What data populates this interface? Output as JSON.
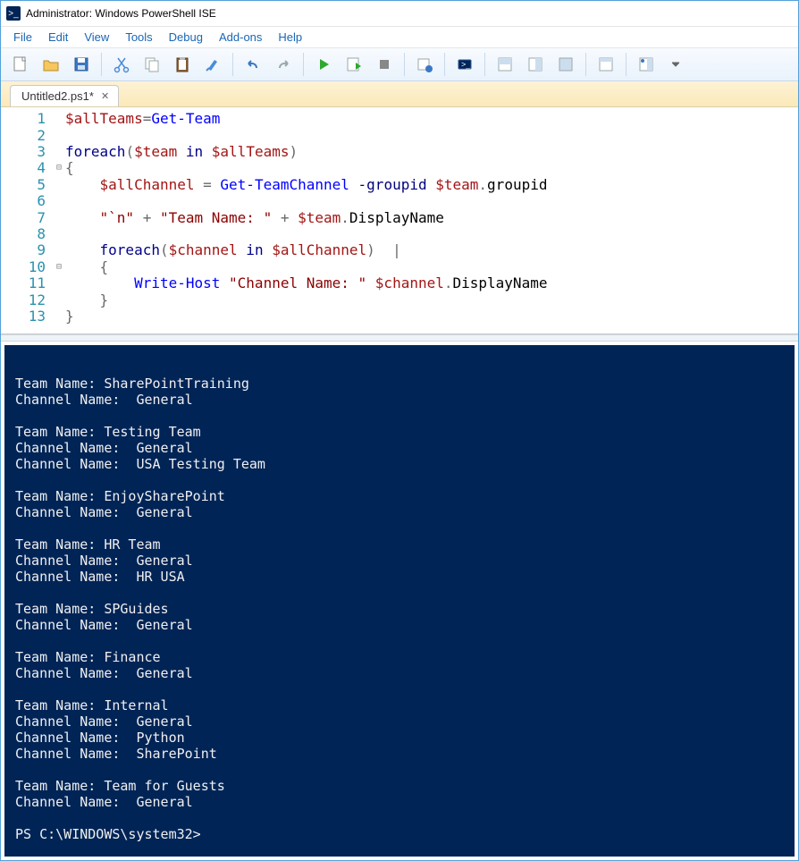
{
  "window": {
    "title": "Administrator: Windows PowerShell ISE"
  },
  "menu": {
    "items": [
      "File",
      "Edit",
      "View",
      "Tools",
      "Debug",
      "Add-ons",
      "Help"
    ]
  },
  "toolbar": {
    "buttons": [
      "new-file",
      "open-file",
      "save-file",
      "cut",
      "copy",
      "paste",
      "clear",
      "undo",
      "redo",
      "run",
      "run-selection",
      "stop",
      "breakpoint",
      "remote",
      "show-script",
      "show-console",
      "show-both",
      "show-command",
      "toggle-right-pane",
      "options"
    ]
  },
  "tabs": {
    "active": {
      "label": "Untitled2.ps1*",
      "close": "✕"
    }
  },
  "editor": {
    "lines": [
      {
        "n": 1,
        "tokens": [
          [
            "var",
            "$allTeams"
          ],
          [
            "op",
            "="
          ],
          [
            "cmd",
            "Get-Team"
          ]
        ]
      },
      {
        "n": 2,
        "tokens": []
      },
      {
        "n": 3,
        "tokens": [
          [
            "kw",
            "foreach"
          ],
          [
            "op",
            "("
          ],
          [
            "var",
            "$team"
          ],
          [
            "kw",
            " in "
          ],
          [
            "var",
            "$allTeams"
          ],
          [
            "op",
            ")"
          ]
        ]
      },
      {
        "n": 4,
        "fold": "⊟",
        "tokens": [
          [
            "op",
            "{"
          ]
        ]
      },
      {
        "n": 5,
        "tokens": [
          [
            "",
            "    "
          ],
          [
            "var",
            "$allChannel"
          ],
          [
            "op",
            " = "
          ],
          [
            "cmd",
            "Get-TeamChannel"
          ],
          [
            "param",
            " -groupid "
          ],
          [
            "var",
            "$team"
          ],
          [
            "op",
            "."
          ],
          [
            "prop",
            "groupid"
          ]
        ]
      },
      {
        "n": 6,
        "tokens": []
      },
      {
        "n": 7,
        "tokens": [
          [
            "",
            "    "
          ],
          [
            "str",
            "\"`n\""
          ],
          [
            "op",
            " + "
          ],
          [
            "str",
            "\"Team Name: \""
          ],
          [
            "op",
            " + "
          ],
          [
            "var",
            "$team"
          ],
          [
            "op",
            "."
          ],
          [
            "prop",
            "DisplayName"
          ]
        ]
      },
      {
        "n": 8,
        "tokens": []
      },
      {
        "n": 9,
        "tokens": [
          [
            "",
            "    "
          ],
          [
            "kw",
            "foreach"
          ],
          [
            "op",
            "("
          ],
          [
            "var",
            "$channel"
          ],
          [
            "kw",
            " in "
          ],
          [
            "var",
            "$allChannel"
          ],
          [
            "op",
            ")  |"
          ]
        ]
      },
      {
        "n": 10,
        "fold": "⊟",
        "tokens": [
          [
            "",
            "    "
          ],
          [
            "op",
            "{"
          ]
        ]
      },
      {
        "n": 11,
        "tokens": [
          [
            "",
            "        "
          ],
          [
            "cmd",
            "Write-Host"
          ],
          [
            "",
            " "
          ],
          [
            "str",
            "\"Channel Name: \""
          ],
          [
            "",
            " "
          ],
          [
            "var",
            "$channel"
          ],
          [
            "op",
            "."
          ],
          [
            "prop",
            "DisplayName"
          ]
        ]
      },
      {
        "n": 12,
        "tokens": [
          [
            "",
            "    "
          ],
          [
            "op",
            "}"
          ]
        ]
      },
      {
        "n": 13,
        "tokens": [
          [
            "op",
            "}"
          ]
        ]
      }
    ]
  },
  "console": {
    "lines": [
      "",
      "Team Name: SharePointTraining",
      "Channel Name:  General",
      "",
      "Team Name: Testing Team",
      "Channel Name:  General",
      "Channel Name:  USA Testing Team",
      "",
      "Team Name: EnjoySharePoint",
      "Channel Name:  General",
      "",
      "Team Name: HR Team",
      "Channel Name:  General",
      "Channel Name:  HR USA",
      "",
      "Team Name: SPGuides",
      "Channel Name:  General",
      "",
      "Team Name: Finance",
      "Channel Name:  General",
      "",
      "Team Name: Internal",
      "Channel Name:  General",
      "Channel Name:  Python",
      "Channel Name:  SharePoint",
      "",
      "Team Name: Team for Guests",
      "Channel Name:  General",
      "",
      "PS C:\\WINDOWS\\system32>"
    ]
  }
}
